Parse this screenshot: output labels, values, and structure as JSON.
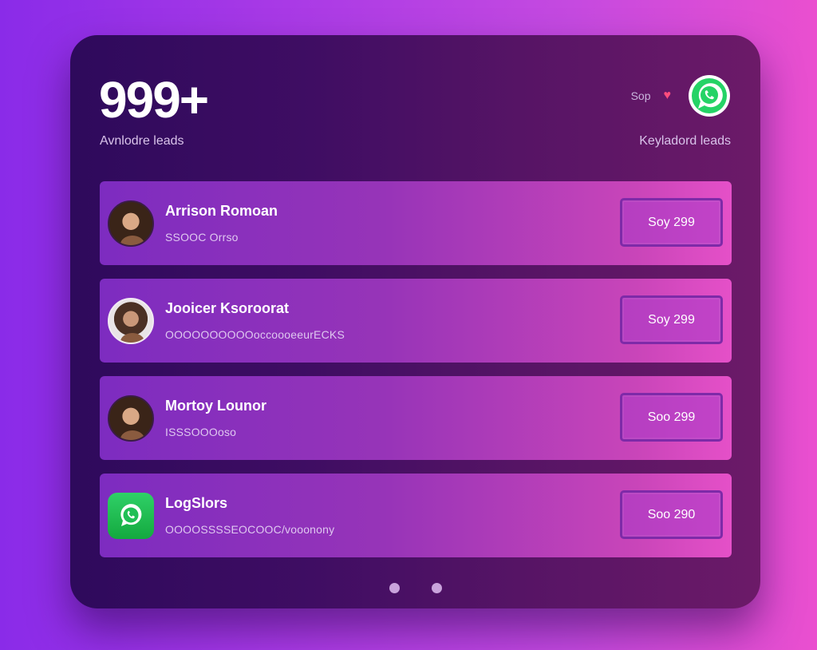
{
  "stats": {
    "count": "999+",
    "left_label": "Avnlodre leads",
    "right_label": "Keyladord leads",
    "top_small_text": "Sop"
  },
  "icons": {
    "heart": "heart-icon",
    "whatsapp": "whatsapp-icon"
  },
  "leads": [
    {
      "name": "Arrison Romoan",
      "detail": "SSOOC Orrso",
      "price": "Soy 299",
      "avatar": "person-avatar"
    },
    {
      "name": "Jooicer Ksoroorat",
      "detail": "OOOOOOOOOOoccoooeeurECKS",
      "price": "Soy 299",
      "avatar": "person-avatar"
    },
    {
      "name": "Mortoy Lounor",
      "detail": "ISSSOOOoso",
      "price": "Soo 299",
      "avatar": "person-avatar"
    },
    {
      "name": "LogSlors",
      "detail": "OOOOSSSSEOCOOC/vooonony",
      "price": "Soo 290",
      "avatar": "whatsapp-avatar"
    }
  ],
  "pagination": {
    "page_count": 2,
    "active_index": 0
  },
  "colors": {
    "accent_green": "#25d366",
    "heart_red": "#ff4d7d",
    "card_bg": "#3f0d63"
  }
}
